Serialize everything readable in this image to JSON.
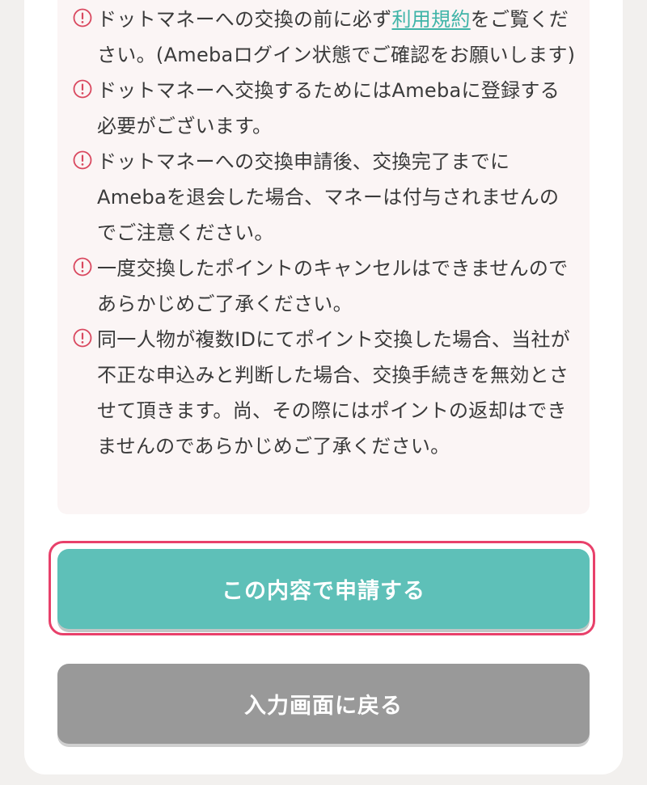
{
  "notices": [
    {
      "icon": "exclamation-circle-icon",
      "text_before": "ドットマネーへの交換の前に必ず",
      "link": "利用規約",
      "text_after": "をご覧ください。(Amebaログイン状態でご確認をお願いします)"
    },
    {
      "icon": "exclamation-circle-icon",
      "text": "ドットマネーへ交換するためにはAmebaに登録する必要がございます。"
    },
    {
      "icon": "exclamation-circle-icon",
      "text": "ドットマネーへの交換申請後、交換完了までにAmebaを退会した場合、マネーは付与されませんのでご注意ください。"
    },
    {
      "icon": "exclamation-circle-icon",
      "text": "一度交換したポイントのキャンセルはできませんのであらかじめご了承ください。"
    },
    {
      "icon": "exclamation-circle-icon",
      "text": "同一人物が複数IDにてポイント交換した場合、当社が不正な申込みと判断した場合、交換手続きを無効とさせて頂きます。尚、その際にはポイントの返却はできませんのであらかじめご了承ください。"
    }
  ],
  "buttons": {
    "submit_label": "この内容で申請する",
    "back_label": "入力画面に戻る"
  },
  "colors": {
    "primary": "#5ec0b8",
    "secondary": "#999999",
    "highlight": "#e8406a",
    "warning": "#d9485f",
    "link": "#3fb4a8"
  }
}
